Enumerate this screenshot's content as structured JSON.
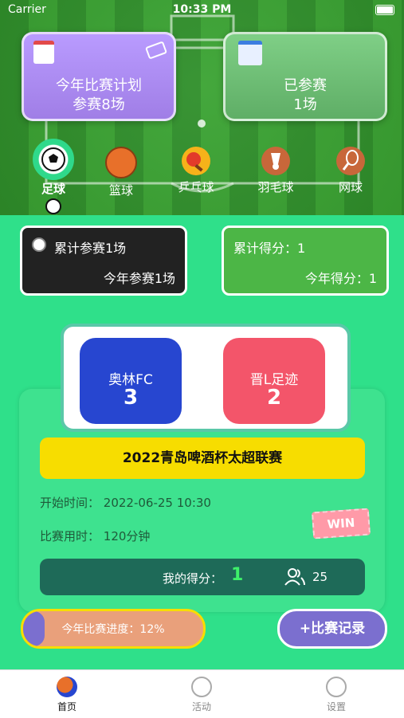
{
  "status": {
    "carrier": "Carrier",
    "time": "10:33 PM"
  },
  "plan_card": {
    "title": "今年比赛计划",
    "count": "参赛8场"
  },
  "joined_card": {
    "title": "已参赛",
    "count": "1场"
  },
  "sports": [
    {
      "label": "足球",
      "icon": "soccer-ball-icon",
      "color": "#ffffff"
    },
    {
      "label": "篮球",
      "icon": "basketball-icon",
      "color": "#e8702a"
    },
    {
      "label": "乒乓球",
      "icon": "table-tennis-icon",
      "color": "#f6b21a"
    },
    {
      "label": "羽毛球",
      "icon": "badminton-icon",
      "color": "#c8673a"
    },
    {
      "label": "网球",
      "icon": "tennis-icon",
      "color": "#c8673a"
    }
  ],
  "summary": {
    "total_label": "累计参赛1场",
    "year_label": "今年参赛1场",
    "score_label": "累计得分：1",
    "year_score_label": "今年得分：1"
  },
  "match": {
    "team_a": {
      "name": "奥林FC",
      "score": "3",
      "color": "#2746d0"
    },
    "team_b": {
      "name": "晋L足迹",
      "score": "2",
      "color": "#f3556a"
    },
    "league": "2022青岛啤酒杯太超联赛",
    "start_label": "开始时间：",
    "start_value": "2022-06-25 10:30",
    "duration_label": "比赛用时：",
    "duration_value": "120分钟",
    "result_badge": "WIN",
    "my_score_label": "我的得分：",
    "my_score_value": "1",
    "participants": "25"
  },
  "progress": {
    "label": "今年比赛进度：12%",
    "value": 0.12
  },
  "add_record": "+比赛记录",
  "tabs": [
    {
      "label": "首页",
      "active": true
    },
    {
      "label": "活动",
      "active": false
    },
    {
      "label": "设置",
      "active": false
    }
  ]
}
